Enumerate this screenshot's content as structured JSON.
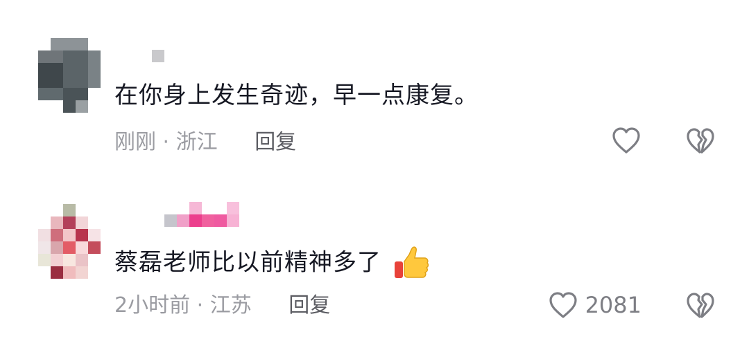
{
  "comments": [
    {
      "text": "在你身上发生奇迹，早一点康复。",
      "time": "刚刚",
      "separator": "·",
      "location": "浙江",
      "reply_label": "回复",
      "like_count": "",
      "avatar_color": "#5b6468"
    },
    {
      "text": "蔡磊老师比以前精神多了",
      "time": "2小时前",
      "separator": "·",
      "location": "江苏",
      "reply_label": "回复",
      "like_count": "2081",
      "avatar_color": "#c44d5c",
      "emoji": "thumbs-up"
    }
  ],
  "icons": {
    "like": "heart-outline-icon",
    "dislike": "broken-heart-icon"
  },
  "colors": {
    "text": "#161823",
    "meta": "#9a9ba1",
    "icon": "#7d7e84"
  }
}
